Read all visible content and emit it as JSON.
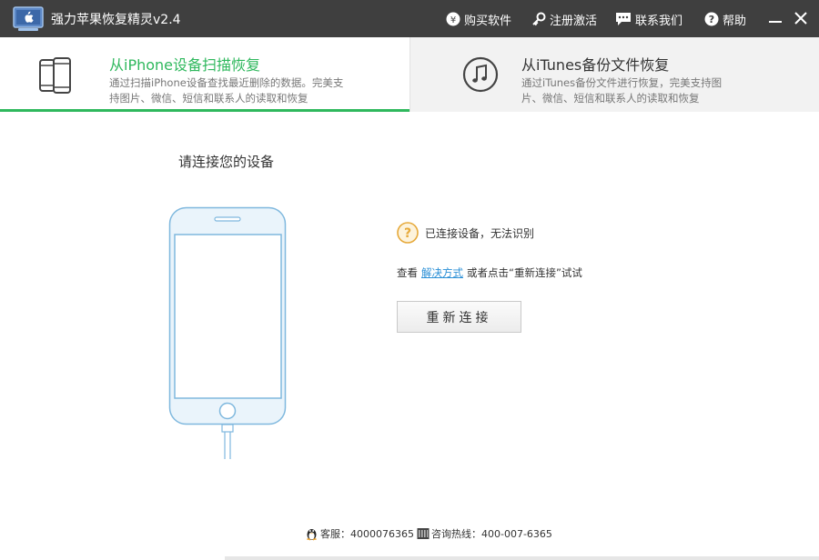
{
  "app": {
    "title": "强力苹果恢复精灵v2.4"
  },
  "toolbar": {
    "buy": "购买软件",
    "register": "注册激活",
    "contact": "联系我们",
    "help": "帮助"
  },
  "tabs": [
    {
      "title": "从iPhone设备扫描恢复",
      "desc": "通过扫描iPhone设备查找最近删除的数据。完美支持图片、微信、短信和联系人的读取和恢复",
      "active": true,
      "icon": "iphone-devices-icon"
    },
    {
      "title": "从iTunes备份文件恢复",
      "desc": "通过iTunes备份文件进行恢复，完美支持图片、微信、短信和联系人的读取和恢复",
      "active": false,
      "icon": "itunes-music-icon"
    }
  ],
  "main": {
    "connect_title": "请连接您的设备",
    "status": "已连接设备，无法识别",
    "hint_prefix": "查看",
    "hint_link": "解决方式",
    "hint_suffix": "或者点击“重新连接”试试",
    "reconnect_label": "重新连接"
  },
  "footer": {
    "service": "客服：4000076365",
    "hotline": "咨询热线：400-007-6365"
  },
  "colors": {
    "accent": "#2fb85d",
    "titlebar": "#3f3f3f",
    "link": "#2a8fd6",
    "phone_stroke": "#7fb8de"
  }
}
